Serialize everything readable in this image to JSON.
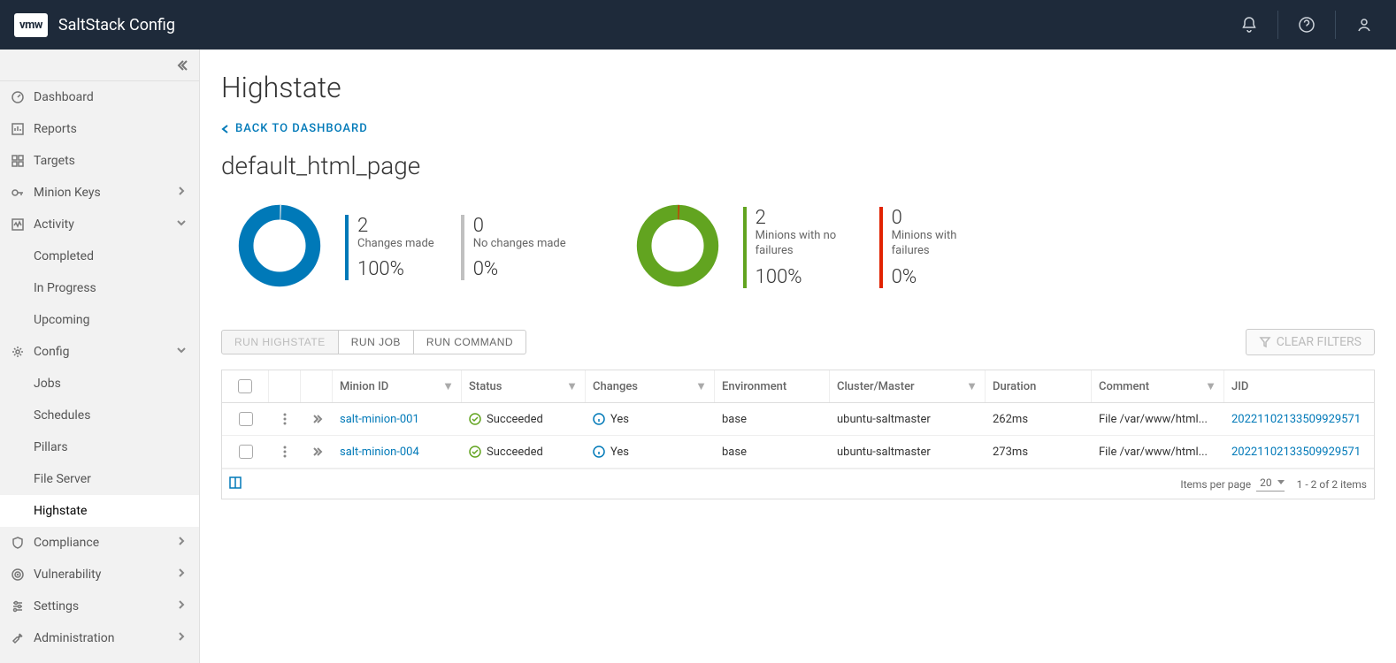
{
  "header": {
    "logo_abbrev": "vmw",
    "app_name": "SaltStack Config"
  },
  "sidebar": {
    "items": [
      {
        "label": "Dashboard",
        "icon": "gauge",
        "expandable": false
      },
      {
        "label": "Reports",
        "icon": "chart",
        "expandable": false
      },
      {
        "label": "Targets",
        "icon": "grid",
        "expandable": false
      },
      {
        "label": "Minion Keys",
        "icon": "key",
        "expandable": true,
        "right": "chevron"
      },
      {
        "label": "Activity",
        "icon": "activity",
        "expandable": true,
        "right": "open",
        "children": [
          {
            "label": "Completed"
          },
          {
            "label": "In Progress"
          },
          {
            "label": "Upcoming"
          }
        ]
      },
      {
        "label": "Config",
        "icon": "gear",
        "expandable": true,
        "right": "open",
        "children": [
          {
            "label": "Jobs"
          },
          {
            "label": "Schedules"
          },
          {
            "label": "Pillars"
          },
          {
            "label": "File Server"
          },
          {
            "label": "Highstate",
            "active": true
          }
        ]
      },
      {
        "label": "Compliance",
        "icon": "shield",
        "expandable": true,
        "right": "chevron"
      },
      {
        "label": "Vulnerability",
        "icon": "target",
        "expandable": true,
        "right": "chevron"
      },
      {
        "label": "Settings",
        "icon": "sliders",
        "expandable": true,
        "right": "chevron"
      },
      {
        "label": "Administration",
        "icon": "tools",
        "expandable": true,
        "right": "chevron"
      }
    ]
  },
  "page": {
    "title": "Highstate",
    "back_link": "BACK TO DASHBOARD",
    "subtitle": "default_html_page",
    "chart_data": [
      {
        "type": "pie",
        "title": "Changes",
        "series": [
          {
            "name": "Changes made",
            "value": 2,
            "pct": "100%",
            "color": "#0079b8"
          },
          {
            "name": "No changes made",
            "value": 0,
            "pct": "0%",
            "color": "#c0c0c0"
          }
        ]
      },
      {
        "type": "pie",
        "title": "Minion failures",
        "series": [
          {
            "name": "Minions with no failures",
            "value": 2,
            "pct": "100%",
            "color": "#62a420"
          },
          {
            "name": "Minions with failures",
            "value": 0,
            "pct": "0%",
            "color": "#e12200"
          }
        ]
      }
    ],
    "metrics": {
      "changes_made": {
        "value": "2",
        "label": "Changes made",
        "pct": "100%"
      },
      "no_changes": {
        "value": "0",
        "label": "No changes made",
        "pct": "0%"
      },
      "minions_no_failures": {
        "value": "2",
        "label": "Minions with no failures",
        "pct": "100%"
      },
      "minions_failures": {
        "value": "0",
        "label": "Minions with failures",
        "pct": "0%"
      }
    },
    "buttons": {
      "run_highstate": "RUN HIGHSTATE",
      "run_job": "RUN JOB",
      "run_command": "RUN COMMAND",
      "clear_filters": "CLEAR FILTERS"
    },
    "table": {
      "headers": {
        "minion": "Minion ID",
        "status": "Status",
        "changes": "Changes",
        "env": "Environment",
        "cluster": "Cluster/Master",
        "duration": "Duration",
        "comment": "Comment",
        "jid": "JID"
      },
      "rows": [
        {
          "minion": "salt-minion-001",
          "status": "Succeeded",
          "changes": "Yes",
          "env": "base",
          "cluster": "ubuntu-saltmaster",
          "duration": "262ms",
          "comment": "File /var/www/html...",
          "jid": "20221102133509929571"
        },
        {
          "minion": "salt-minion-004",
          "status": "Succeeded",
          "changes": "Yes",
          "env": "base",
          "cluster": "ubuntu-saltmaster",
          "duration": "273ms",
          "comment": "File /var/www/html...",
          "jid": "20221102133509929571"
        }
      ],
      "footer": {
        "items_per_page_label": "Items per page",
        "items_per_page_value": "20",
        "range": "1 - 2 of 2 items"
      }
    }
  }
}
